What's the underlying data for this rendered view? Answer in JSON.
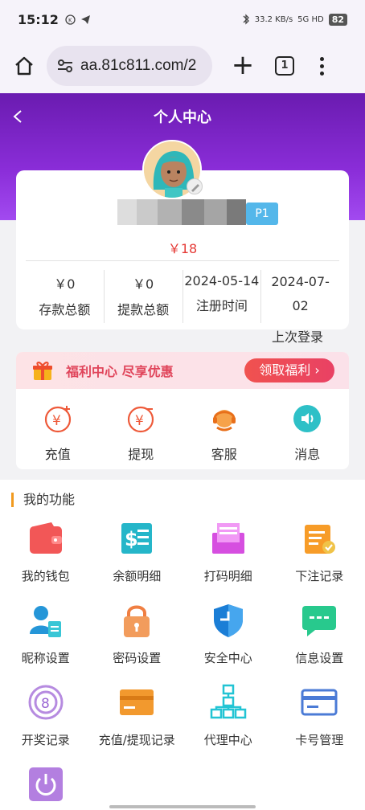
{
  "status_bar": {
    "time": "15:12",
    "speed": "33.2 KB/s",
    "network": "5G HD",
    "battery": "82"
  },
  "browser": {
    "url": "aa.81c811.com/2",
    "tab_count": "1"
  },
  "header": {
    "title": "个人中心"
  },
  "profile": {
    "vip": "P1",
    "balance": "￥18",
    "stats": [
      {
        "value": "￥0",
        "label": "存款总额"
      },
      {
        "value": "￥0",
        "label": "提款总额"
      },
      {
        "value": "2024-05-14",
        "label": "注册时间"
      }
    ],
    "last_login": {
      "value_line1": "2024-07-",
      "value_line2": "02",
      "label": "上次登录"
    }
  },
  "welfare": {
    "text": "福利中心 尽享优惠",
    "button": "领取福利 ›"
  },
  "quick_actions": [
    {
      "label": "充值",
      "icon": "deposit-icon"
    },
    {
      "label": "提现",
      "icon": "withdraw-icon"
    },
    {
      "label": "客服",
      "icon": "customer-service-icon"
    },
    {
      "label": "消息",
      "icon": "message-icon"
    }
  ],
  "functions": {
    "title": "我的功能",
    "items": [
      {
        "label": "我的钱包",
        "icon": "wallet-icon"
      },
      {
        "label": "余额明细",
        "icon": "balance-detail-icon"
      },
      {
        "label": "打码明细",
        "icon": "bet-code-icon"
      },
      {
        "label": "下注记录",
        "icon": "bet-record-icon"
      },
      {
        "label": "昵称设置",
        "icon": "nickname-icon"
      },
      {
        "label": "密码设置",
        "icon": "lock-icon"
      },
      {
        "label": "安全中心",
        "icon": "shield-icon"
      },
      {
        "label": "信息设置",
        "icon": "chat-icon"
      },
      {
        "label": "开奖记录",
        "icon": "lottery-icon"
      },
      {
        "label": "充值/提现记录",
        "icon": "card-record-icon"
      },
      {
        "label": "代理中心",
        "icon": "agent-tree-icon"
      },
      {
        "label": "卡号管理",
        "icon": "bank-card-icon"
      },
      {
        "label": "",
        "icon": "power-icon"
      }
    ]
  },
  "colors": {
    "header_start": "#6a1bb0",
    "header_end": "#a24af0",
    "accent_red": "#e53935",
    "title_bar": "#f19a1f"
  }
}
